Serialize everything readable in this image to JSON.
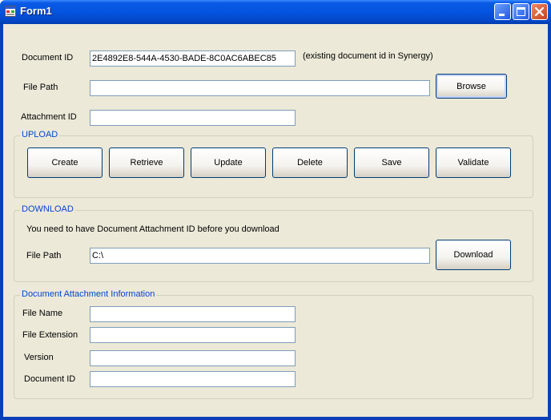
{
  "window": {
    "title": "Form1",
    "controls": [
      "minimize-icon",
      "maximize-icon",
      "close-icon"
    ]
  },
  "form": {
    "document_id_label": "Document ID",
    "document_id_value": "2E4892E8-544A-4530-BADE-8C0AC6ABEC85",
    "document_id_hint": "(existing document id in Synergy)",
    "file_path_label": "File Path",
    "file_path_value": "",
    "browse_label": "Browse",
    "attachment_id_label": "Attachment ID",
    "attachment_id_value": ""
  },
  "upload": {
    "title": "UPLOAD",
    "buttons": [
      "Create",
      "Retrieve",
      "Update",
      "Delete",
      "Save",
      "Validate"
    ]
  },
  "download": {
    "title": "DOWNLOAD",
    "note": "You need to have Document Attachment ID before you download",
    "file_path_label": "File Path",
    "file_path_value": "C:\\",
    "download_label": "Download"
  },
  "info": {
    "title": "Document Attachment Information",
    "fields": [
      {
        "label": "File Name",
        "value": ""
      },
      {
        "label": "File Extension",
        "value": ""
      },
      {
        "label": "Version",
        "value": ""
      },
      {
        "label": "Document ID",
        "value": ""
      }
    ]
  },
  "colors": {
    "titlebar": "#0454e0",
    "client_bg": "#ece9d8",
    "group_title": "#0046d5",
    "input_border": "#7f9db9",
    "button_border": "#003c74"
  }
}
